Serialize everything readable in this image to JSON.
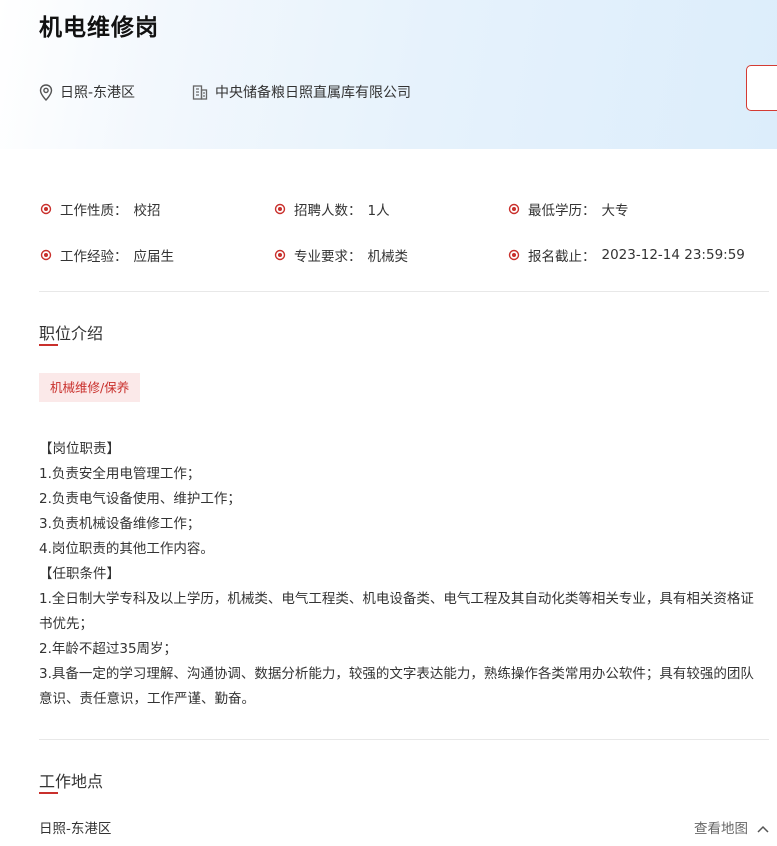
{
  "header": {
    "title": "机电维修岗",
    "location": "日照-东港区",
    "company": "中央储备粮日照直属库有限公司",
    "location_icon": "map-pin-icon",
    "company_icon": "building-icon"
  },
  "info": {
    "items": [
      {
        "label": "工作性质：",
        "value": "校招"
      },
      {
        "label": "招聘人数：",
        "value": "1人"
      },
      {
        "label": "最低学历：",
        "value": "大专"
      },
      {
        "label": "工作经验：",
        "value": "应届生"
      },
      {
        "label": "专业要求：",
        "value": "机械类"
      },
      {
        "label": "报名截止：",
        "value": "2023-12-14 23:59:59"
      }
    ]
  },
  "intro": {
    "title": "职位介绍",
    "tag": "机械维修/保养",
    "lines": [
      "【岗位职责】",
      "1.负责安全用电管理工作；",
      "2.负责电气设备使用、维护工作；",
      "3.负责机械设备维修工作；",
      "4.岗位职责的其他工作内容。",
      "【任职条件】",
      "1.全日制大学专科及以上学历，机械类、电气工程类、机电设备类、电气工程及其自动化类等相关专业，具有相关资格证书优先；",
      "2.年龄不超过35周岁；",
      "3.具备一定的学习理解、沟通协调、数据分析能力，较强的文字表达能力，熟练操作各类常用办公软件；具有较强的团队意识、责任意识，工作严谨、勤奋。"
    ]
  },
  "work_location": {
    "title": "工作地点",
    "address": "日照-东港区",
    "map_link": "查看地图"
  },
  "colors": {
    "accent": "#c9302c",
    "tag_bg": "#fbe9e9",
    "header_bg": "#dcedfb"
  }
}
